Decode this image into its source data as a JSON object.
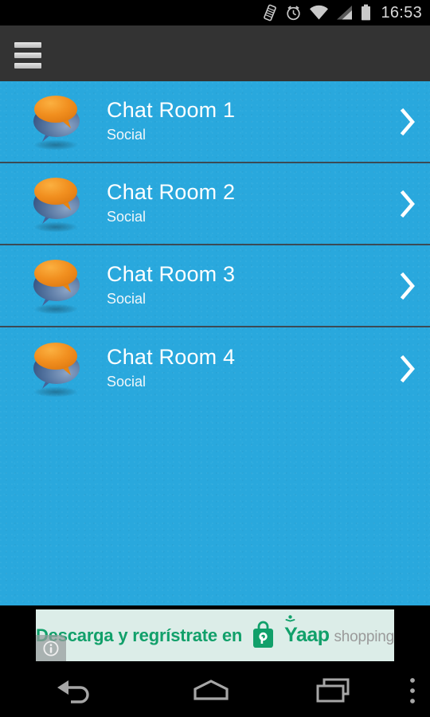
{
  "status_bar": {
    "icons": [
      {
        "name": "vibrate-icon",
        "label": "Vibrate mode"
      },
      {
        "name": "alarm-icon",
        "label": "Alarm set"
      },
      {
        "name": "wifi-icon",
        "label": "Wi-Fi signal"
      },
      {
        "name": "cellular-signal-icon",
        "label": "Cellular signal"
      },
      {
        "name": "battery-icon",
        "label": "Battery full"
      }
    ],
    "clock": "16:53"
  },
  "app_bar": {
    "menu_label": "Menu",
    "background_color": "#333333"
  },
  "content": {
    "background_color": "#29a8dd",
    "divider_color": "#3b4a55",
    "rows": [
      {
        "title": "Chat Room 1",
        "subtitle": "Social",
        "icon": "chat-bubbles-icon",
        "chevron": "chevron-right-icon"
      },
      {
        "title": "Chat Room 2",
        "subtitle": "Social",
        "icon": "chat-bubbles-icon",
        "chevron": "chevron-right-icon"
      },
      {
        "title": "Chat Room 3",
        "subtitle": "Social",
        "icon": "chat-bubbles-icon",
        "chevron": "chevron-right-icon"
      },
      {
        "title": "Chat Room 4",
        "subtitle": "Social",
        "icon": "chat-bubbles-icon",
        "chevron": "chevron-right-icon"
      }
    ],
    "icon_colors": {
      "front_bubble": "#f08a1e",
      "back_bubble": "#3c5f93"
    }
  },
  "ad": {
    "text": "Descarga y regrístrate en",
    "brand": "Yaap",
    "brand_sub": "shopping",
    "background_color": "#dcede8",
    "brand_color": "#11a06a",
    "info_label": "i"
  },
  "nav_bar": {
    "buttons": [
      {
        "name": "nav-back",
        "label": "Back"
      },
      {
        "name": "nav-home",
        "label": "Home"
      },
      {
        "name": "nav-recents",
        "label": "Recent apps"
      },
      {
        "name": "nav-overflow",
        "label": "More options"
      }
    ]
  }
}
